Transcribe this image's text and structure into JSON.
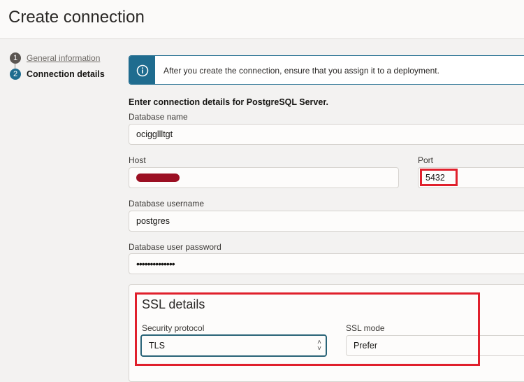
{
  "header": {
    "title": "Create connection"
  },
  "steps": [
    {
      "num": "1",
      "label": "General information"
    },
    {
      "num": "2",
      "label": "Connection details"
    }
  ],
  "banner": {
    "icon": "info-icon",
    "text": "After you create the connection, ensure that you assign it to a deployment."
  },
  "form": {
    "heading": "Enter connection details for PostgreSQL Server.",
    "database_name": {
      "label": "Database name",
      "value": "ociggllltgt"
    },
    "host": {
      "label": "Host",
      "value": ""
    },
    "port": {
      "label": "Port",
      "value": "5432"
    },
    "username": {
      "label": "Database username",
      "value": "postgres"
    },
    "password": {
      "label": "Database user password",
      "value": "••••••••••••••"
    }
  },
  "ssl": {
    "title": "SSL details",
    "protocol": {
      "label": "Security protocol",
      "value": "TLS"
    },
    "mode": {
      "label": "SSL mode",
      "value": "Prefer"
    }
  },
  "colors": {
    "accent": "#1f6c8f",
    "highlight": "#e0202c"
  }
}
